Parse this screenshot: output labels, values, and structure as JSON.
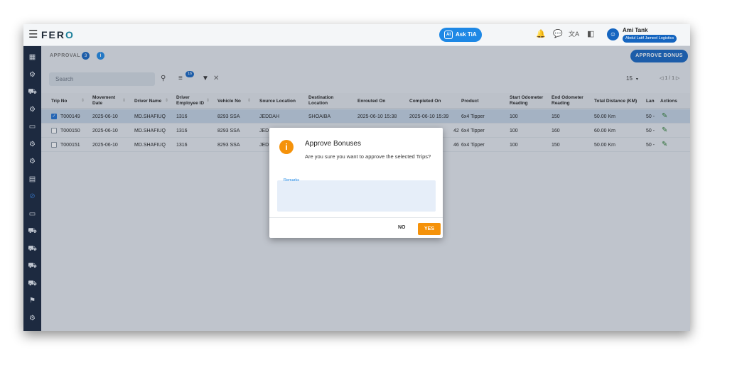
{
  "app": {
    "menu_icon": "☰",
    "logo_main": "FER",
    "logo_accent": "O"
  },
  "header": {
    "ask_label": "Ask TiA",
    "ask_icon": "AI",
    "user_name": "Ami Tank",
    "company": "Abdul Latif Jameel Logistics"
  },
  "header_icons": {
    "bell": "🔔",
    "chat": "💬",
    "translate": "文A",
    "panel": "◧",
    "avatar": "☺"
  },
  "sidebar": {
    "icons": [
      "▦",
      "⚙",
      "⛟",
      "⚙",
      "▭",
      "⚙",
      "⚙",
      "▤",
      "⊘",
      "▭",
      "⛟",
      "⛟",
      "⛟",
      "⛟",
      "⚑",
      "⚙"
    ]
  },
  "tab": {
    "label": "APPROVAL",
    "count": "3",
    "info": "i"
  },
  "toolbar": {
    "approve_button": "APPROVE BONUS",
    "search_placeholder": "Search",
    "search_icon": "⚲",
    "filter_count_icon": "≡",
    "filter_count": "16",
    "filter_icon": "▼",
    "clear_filter_icon": "✕",
    "page_size": "15",
    "page_size_chevron": "▾",
    "pager_prev": "◁",
    "pager": "1 / 1",
    "pager_next": "▷"
  },
  "columns": [
    "Trip No",
    "Movement Date",
    "Driver Name",
    "Driver Employee ID",
    "Vehicle No",
    "Source Location",
    "Destination Location",
    "Enrouted On",
    "Completed On",
    "Product",
    "Start Odometer Reading",
    "End Odometer Reading",
    "Total Distance (KM)",
    "Lan",
    "Actions"
  ],
  "sort_icon": "⇕",
  "rows": [
    {
      "selected": true,
      "trip": "T000149",
      "date": "2025-06-10",
      "driver": "MD.SHAFIUQ",
      "emp": "1316",
      "vehicle": "8293 SSA",
      "src": "JEDDAH",
      "dst": "SHOAIBA",
      "enrouted": "2025-06-10 15:38",
      "completed": "2025-06-10 15:39",
      "product": "6x4 Tipper",
      "start": "100",
      "end": "150",
      "dist": "50.00 Km",
      "lan": "50 -",
      "check": "✓",
      "edit": "✎"
    },
    {
      "selected": false,
      "trip": "T000150",
      "date": "2025-06-10",
      "driver": "MD.SHAFIUQ",
      "emp": "1316",
      "vehicle": "8293 SSA",
      "src": "JEDI",
      "dst": "",
      "enrouted": "",
      "completed": "42",
      "product": "6x4 Tipper",
      "start": "100",
      "end": "160",
      "dist": "60.00 Km",
      "lan": "50 -",
      "check": "",
      "edit": "✎"
    },
    {
      "selected": false,
      "trip": "T000151",
      "date": "2025-06-10",
      "driver": "MD.SHAFIUQ",
      "emp": "1316",
      "vehicle": "8293 SSA",
      "src": "JEDI",
      "dst": "",
      "enrouted": "",
      "completed": "46",
      "product": "6x4 Tipper",
      "start": "100",
      "end": "150",
      "dist": "50.00 Km",
      "lan": "50 -",
      "check": "",
      "edit": "✎"
    }
  ],
  "dialog": {
    "icon": "i",
    "title": "Approve Bonuses",
    "message": "Are you sure you want to approve the selected Trips?",
    "remarks_label": "Remarks",
    "remarks_value": "",
    "no": "NO",
    "yes": "YES"
  },
  "colors": {
    "primary": "#1565c0",
    "sidebar": "#15233a",
    "accent": "#f5920a",
    "edit": "#2e7d32"
  }
}
